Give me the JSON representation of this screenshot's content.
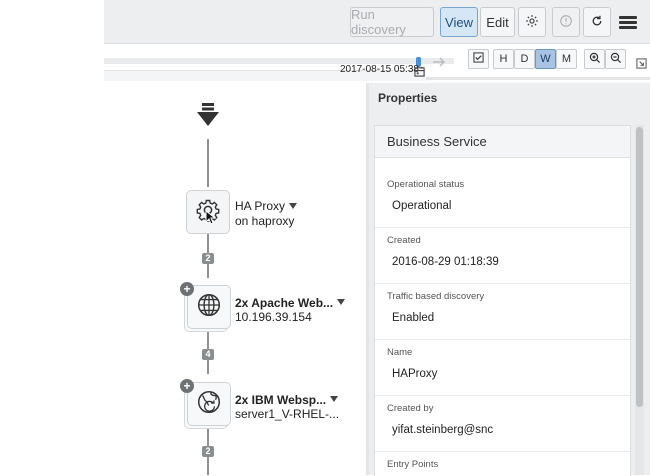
{
  "toolbar": {
    "run_discovery_label": "Run discovery",
    "view_label": "View",
    "edit_label": "Edit",
    "icons": [
      "gear-icon",
      "info-icon",
      "refresh-icon",
      "menu-icon"
    ]
  },
  "timeline": {
    "date": "2017-08-15 05:38",
    "scale_buttons": [
      "H",
      "D",
      "W",
      "M"
    ],
    "active_scale": "W"
  },
  "map": {
    "nodes": [
      {
        "title": "HA Proxy",
        "subtitle": "on haproxy",
        "icon": "gear-icon"
      },
      {
        "title": "2x Apache Web...",
        "subtitle": "10.196.39.154",
        "icon": "globe-icon"
      },
      {
        "title": "2x IBM Websp...",
        "subtitle": "server1_V-RHEL-...",
        "icon": "globe-refresh-icon"
      }
    ],
    "connection_counts": [
      "2",
      "4",
      "2"
    ]
  },
  "properties": {
    "header": "Properties",
    "card_title": "Business Service",
    "fields": [
      {
        "label": "Operational status",
        "value": "Operational"
      },
      {
        "label": "Created",
        "value": "2016-08-29 01:18:39"
      },
      {
        "label": "Traffic based discovery",
        "value": "Enabled"
      },
      {
        "label": "Name",
        "value": "HAProxy"
      },
      {
        "label": "Created by",
        "value": "yifat.steinberg@snc"
      },
      {
        "label": "Entry Points",
        "value": ""
      }
    ]
  },
  "colors": {
    "accent": "#4a90d9",
    "active_button": "#d5e6f5"
  }
}
